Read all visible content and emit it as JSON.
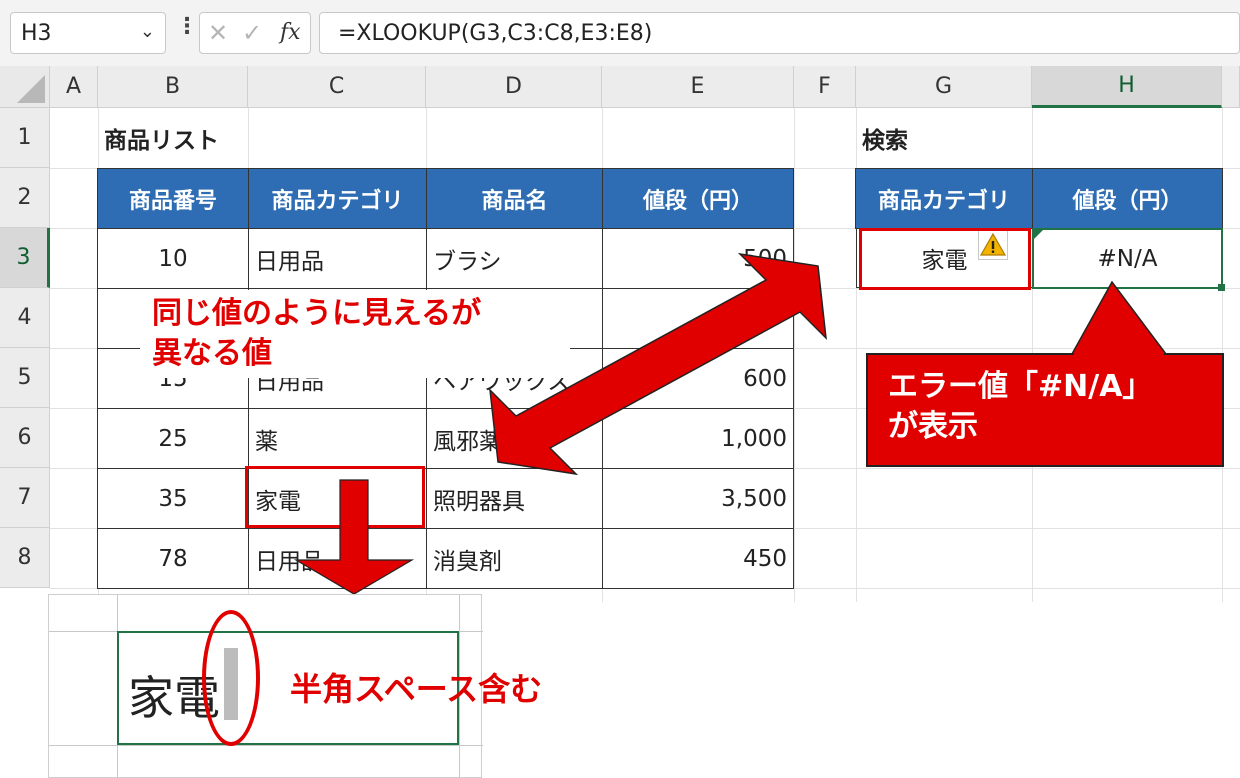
{
  "formula_bar": {
    "name_box": "H3",
    "name_box_chevron": "chevron-down-icon",
    "cancel_glyph": "✕",
    "enter_glyph": "✓",
    "fx_label": "fx",
    "formula": "=XLOOKUP(G3,C3:C8,E3:E8)"
  },
  "columns": [
    "A",
    "B",
    "C",
    "D",
    "E",
    "F",
    "G",
    "H"
  ],
  "rows": [
    "1",
    "2",
    "3",
    "4",
    "5",
    "6",
    "7",
    "8"
  ],
  "product_list": {
    "title": "商品リスト",
    "headers": [
      "商品番号",
      "商品カテゴリ",
      "商品名",
      "値段（円）"
    ],
    "rows": [
      [
        "10",
        "日用品",
        "ブラシ",
        "500"
      ],
      [
        "",
        "",
        "",
        ""
      ],
      [
        "15",
        "日用品",
        "ヘアワックス",
        "600"
      ],
      [
        "25",
        "薬",
        "風邪薬",
        "1,000"
      ],
      [
        "35",
        "家電",
        "照明器具",
        "3,500"
      ],
      [
        "78",
        "日用品",
        "消臭剤",
        "450"
      ]
    ]
  },
  "search": {
    "title": "検索",
    "headers": [
      "商品カテゴリ",
      "値段（円）"
    ],
    "category_value": "家電",
    "result_value": "#N/A",
    "warning_icon": "warning-triangle-icon"
  },
  "annotations": {
    "same_value_line1": "同じ値のように見えるが",
    "same_value_line2": "異なる値",
    "error_line1": "エラー値「#N/A」",
    "error_line2": "が表示",
    "space_label": "半角スペース含む",
    "zoom_text": "家電",
    "annotation_color": "#e00000",
    "header_fill": "#2e6db4"
  }
}
